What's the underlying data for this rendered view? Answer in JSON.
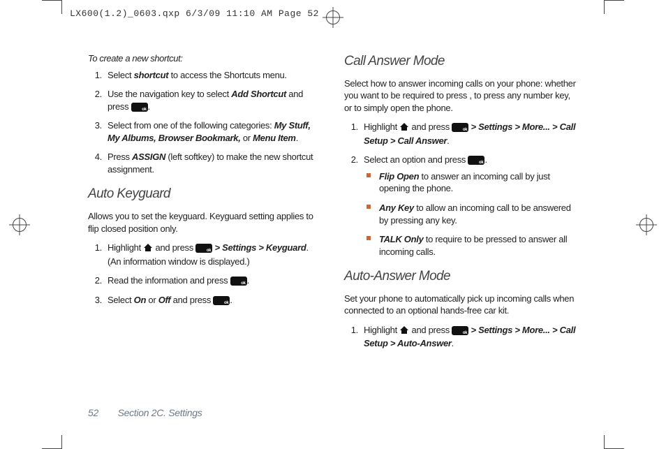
{
  "header": {
    "slug": "LX600(1.2)_0603.qxp  6/3/09  11:10 AM  Page 52"
  },
  "left": {
    "intro": "To create a new shortcut:",
    "steps": [
      {
        "n": "1.",
        "pre": "Select ",
        "em": "shortcut",
        "post": " to access the Shortcuts menu."
      },
      {
        "n": "2.",
        "pre": "Use the navigation key to select  ",
        "em": "Add Shortcut",
        "post": " and press ",
        "icon_ok": true,
        "tail": "."
      },
      {
        "n": "3.",
        "pre": "Select from one of the following categories: ",
        "em": "My Stuff, My Albums, Browser Bookmark,",
        "post": " or ",
        "em2": "Menu Item",
        "tail": "."
      },
      {
        "n": "4.",
        "pre": "Press ",
        "em": "ASSIGN",
        "post": " (left softkey) to make the new shortcut assignment."
      }
    ],
    "h_autokey": "Auto Keyguard",
    "autokey_p": "Allows you to set the keyguard. Keyguard setting applies to flip closed position only.",
    "autokey_steps": [
      {
        "n": "1.",
        "pre": "Highlight ",
        "icon_home": true,
        "mid": " and press ",
        "icon_ok": true,
        "em": " > Settings > Keyguard",
        "post": ". (An information window is displayed.)"
      },
      {
        "n": "2.",
        "pre": "Read the information and press ",
        "icon_ok": true,
        "tail": "."
      },
      {
        "n": "3.",
        "pre": "Select ",
        "em": "On",
        "mid": " or ",
        "em2": "Off ",
        "post": " and press ",
        "icon_ok": true,
        "tail": "."
      }
    ]
  },
  "right": {
    "h_cam": "Call Answer Mode",
    "cam_p": "Select how to answer incoming calls on your phone: whether you want to be required to press , to press any number key, or to simply open the phone.",
    "cam_steps": [
      {
        "n": "1.",
        "pre": "Highlight ",
        "icon_home": true,
        "mid": " and press ",
        "icon_ok": true,
        "em": " > Settings > More... > Call Setup > Call Answer",
        "tail": "."
      },
      {
        "n": "2.",
        "pre": "Select an option and press ",
        "icon_ok": true,
        "tail": "."
      }
    ],
    "cam_opts": [
      {
        "em": "Flip Open",
        "post": " to answer an incoming call by just opening the phone."
      },
      {
        "em": "Any Key",
        "post": " to allow an incoming call to be answered by pressing any key."
      },
      {
        "em": "TALK Only",
        "post": " to require to be pressed to answer all incoming calls."
      }
    ],
    "h_aam": "Auto-Answer Mode",
    "aam_p": "Set your phone to automatically pick up incoming calls when connected to an optional hands-free car kit.",
    "aam_steps": [
      {
        "n": "1.",
        "pre": "Highlight ",
        "icon_home": true,
        "mid": " and press ",
        "icon_ok": true,
        "em": " > Settings > More... > Call Setup > Auto-Answer",
        "tail": "."
      }
    ]
  },
  "footer": {
    "page": "52",
    "section": "Section 2C. Settings"
  }
}
